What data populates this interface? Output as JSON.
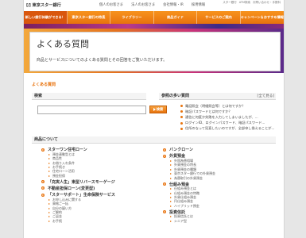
{
  "header": {
    "logo_mark": "[/]",
    "logo_name": "東京スター銀行",
    "top_links": [
      "個人のお客さま",
      "法人のお客さま",
      "会社情報・IR",
      "採用情報"
    ],
    "utility_links": [
      "スター銀行",
      "ATM検索",
      "お問い合わせ・手数料"
    ]
  },
  "nav": {
    "items": [
      "新しい銀行体験ができる！",
      "東京スター銀行の特長",
      "ライブラリー",
      "商品ガイド",
      "サービスのご案内",
      "キャンペーン＆おすすめ情報"
    ]
  },
  "hero": {
    "title": "よくある質問",
    "description": "商品とサービスについてのよくある質問とその回答をご覧いただけます。"
  },
  "breadcrumb": "よくある質問",
  "search": {
    "title": "検索",
    "placeholder": "",
    "button_label": "検索"
  },
  "faq": {
    "title": "参照の多い質問",
    "more_link": "[全て見る]",
    "items": [
      "電話照会（明細照会等）とは何ですか？",
      "暗証パスワードとは何ですか？",
      "通信に何度か失敗を入力してしまいましたが、...",
      "ログインID、ログインパスワード、暗証パスワード...",
      "住所のなって見直したいのですが、全部申し換えることが..."
    ]
  },
  "products": {
    "title": "商品について",
    "left": [
      {
        "label": "スターワン住宅ローン",
        "subs": [
          "預金連動型とは",
          "商品性",
          "お借り入れ条件",
          "お手続き",
          "住宅ローン活用",
          "預金担保"
        ]
      },
      {
        "label": "「充実人生」東型リバースモーゲージ",
        "subs": []
      },
      {
        "label": "不動産担保ローン(変更型)",
        "subs": []
      },
      {
        "label": "「スターサポート」生命保険サービス",
        "subs": [
          "お申し込みに関する",
          "資格ご一括",
          "自分の疑い方",
          "ご解約",
          "ご返金",
          "お手続"
        ]
      }
    ],
    "right": [
      {
        "label": "バンクローン",
        "subs": []
      },
      {
        "label": "外貨預金",
        "subs": [
          "外国為替相場",
          "外貨預金の特長",
          "外貨預金の種類",
          "東京スター銀行での外貨預金",
          "為替取引の外貨預金"
        ]
      },
      {
        "label": "仕組み預金",
        "subs": [
          "仕組み預金とは",
          "仕組み預金の特徴",
          "外貨仕組み預金",
          "円仕組み預金",
          "ハイブリッド預金"
        ]
      },
      {
        "label": "投資信託",
        "subs": [
          "投資信託とは",
          "シニア型"
        ]
      }
    ]
  },
  "colors": {
    "accent": "#e8730d",
    "nav_gradient_top": "#f7931e",
    "active_nav": "#d9560d"
  }
}
